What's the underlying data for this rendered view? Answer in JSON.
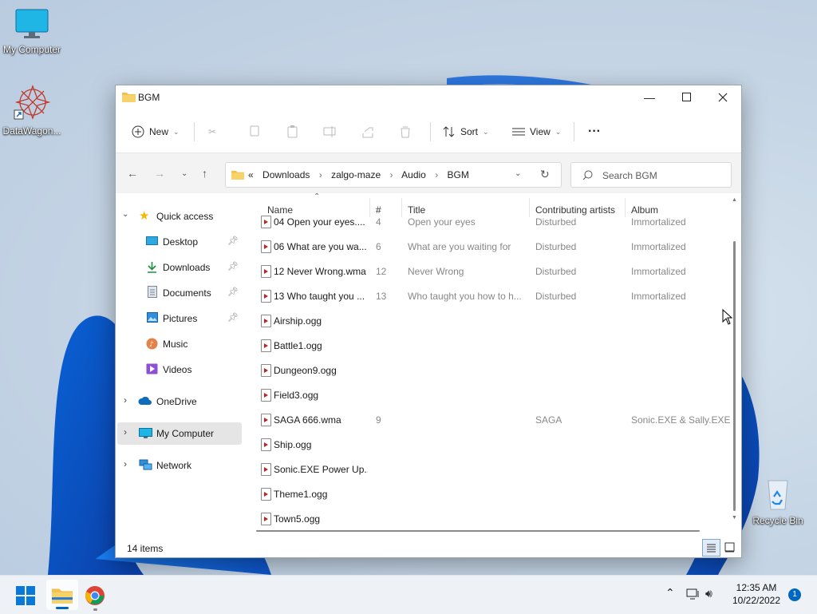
{
  "desktop": {
    "icons": [
      {
        "label": "My Computer",
        "icon": "monitor-icon"
      },
      {
        "label": "DataWagon...",
        "icon": "shortcut-icon"
      },
      {
        "label": "Recycle Bin",
        "icon": "recycle-bin-icon"
      }
    ]
  },
  "window": {
    "title": "BGM",
    "controls": {
      "minimize": "minimize-icon",
      "maximize": "maximize-icon",
      "close": "close-icon"
    }
  },
  "toolbar": {
    "new_label": "New",
    "sort_label": "Sort",
    "view_label": "View",
    "more_label": "···"
  },
  "address": {
    "overflow": "«",
    "crumbs": [
      "Downloads",
      "zalgo-maze",
      "Audio",
      "BGM"
    ],
    "search_placeholder": "Search BGM"
  },
  "sidebar": {
    "items": [
      {
        "label": "Quick access",
        "icon": "star-icon"
      },
      {
        "label": "Desktop",
        "icon": "desktop-icon",
        "pinned": true
      },
      {
        "label": "Downloads",
        "icon": "download-arrow-icon",
        "pinned": true
      },
      {
        "label": "Documents",
        "icon": "document-icon",
        "pinned": true
      },
      {
        "label": "Pictures",
        "icon": "picture-icon",
        "pinned": true
      },
      {
        "label": "Music",
        "icon": "music-icon"
      },
      {
        "label": "Videos",
        "icon": "video-icon"
      },
      {
        "label": "OneDrive",
        "icon": "cloud-icon"
      },
      {
        "label": "My Computer",
        "icon": "monitor-icon",
        "selected": true
      },
      {
        "label": "Network",
        "icon": "network-icon"
      }
    ]
  },
  "columns": {
    "name": "Name",
    "num": "#",
    "title": "Title",
    "artists": "Contributing artists",
    "album": "Album"
  },
  "files": [
    {
      "name": "04 Open your eyes....",
      "num": "4",
      "title": "Open your eyes",
      "artist": "Disturbed",
      "album": "Immortalized"
    },
    {
      "name": "06 What are you wa...",
      "num": "6",
      "title": "What are you waiting for",
      "artist": "Disturbed",
      "album": "Immortalized"
    },
    {
      "name": "12 Never Wrong.wma",
      "num": "12",
      "title": "Never Wrong",
      "artist": "Disturbed",
      "album": "Immortalized"
    },
    {
      "name": "13 Who taught you ...",
      "num": "13",
      "title": "Who taught you how to h...",
      "artist": "Disturbed",
      "album": "Immortalized"
    },
    {
      "name": "Airship.ogg",
      "num": "",
      "title": "",
      "artist": "",
      "album": ""
    },
    {
      "name": "Battle1.ogg",
      "num": "",
      "title": "",
      "artist": "",
      "album": ""
    },
    {
      "name": "Dungeon9.ogg",
      "num": "",
      "title": "",
      "artist": "",
      "album": ""
    },
    {
      "name": "Field3.ogg",
      "num": "",
      "title": "",
      "artist": "",
      "album": ""
    },
    {
      "name": "SAGA 666.wma",
      "num": "9",
      "title": "",
      "artist": "SAGA",
      "album": "Sonic.EXE & Sally.EXE"
    },
    {
      "name": "Ship.ogg",
      "num": "",
      "title": "",
      "artist": "",
      "album": ""
    },
    {
      "name": "Sonic.EXE Power Up...",
      "num": "",
      "title": "",
      "artist": "",
      "album": ""
    },
    {
      "name": "Theme1.ogg",
      "num": "",
      "title": "",
      "artist": "",
      "album": ""
    },
    {
      "name": "Town5.ogg",
      "num": "",
      "title": "",
      "artist": "",
      "album": ""
    }
  ],
  "status": {
    "items": "14 items"
  },
  "taskbar": {
    "time": "12:35 AM",
    "date": "10/22/2022",
    "notification_count": "1"
  },
  "colors": {
    "accent": "#0067c0",
    "folder": "#f2c14e",
    "selected_bg": "#e5e5e5"
  }
}
